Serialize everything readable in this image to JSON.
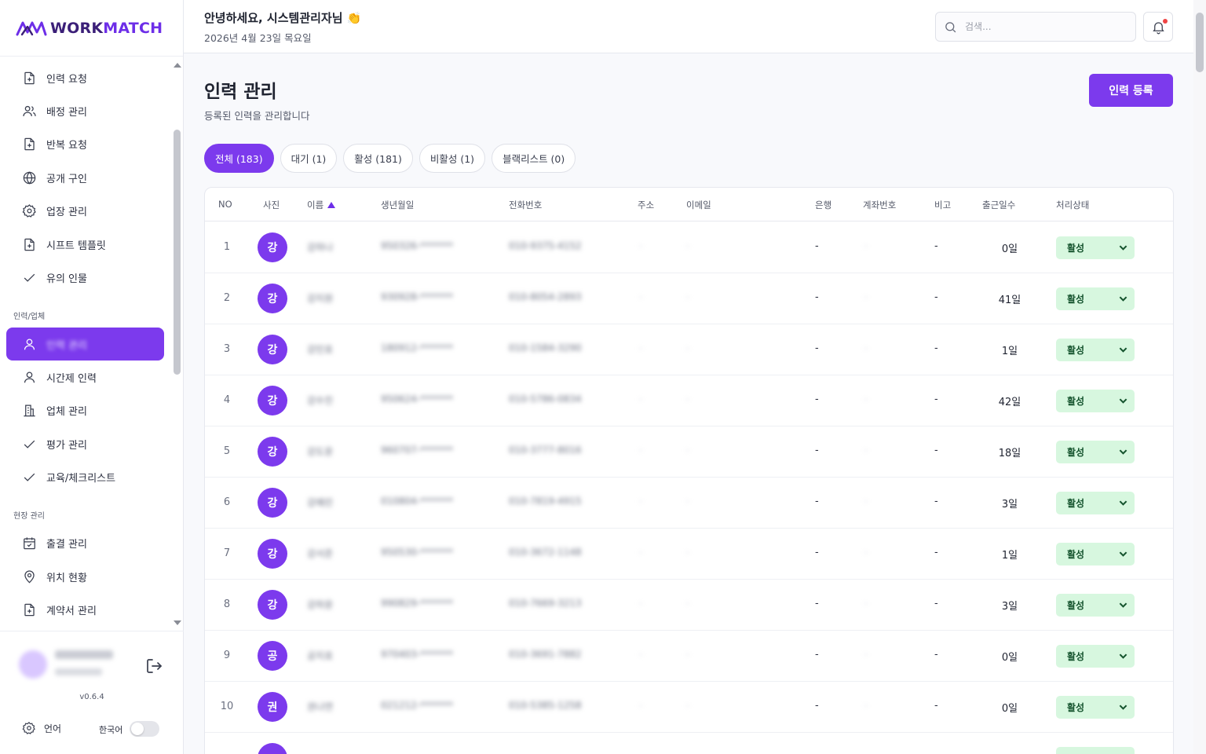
{
  "brand": {
    "name_a": "WORK",
    "name_b": "MATCH",
    "accent": "#7c3aed"
  },
  "sidebar": {
    "items": [
      {
        "label": "인력 요청",
        "icon": "file-plus-icon"
      },
      {
        "label": "배정 관리",
        "icon": "users-icon"
      },
      {
        "label": "반복 요청",
        "icon": "file-plus-icon"
      },
      {
        "label": "공개 구인",
        "icon": "globe-icon"
      },
      {
        "label": "업장 관리",
        "icon": "gear-icon"
      },
      {
        "label": "시프트 템플릿",
        "icon": "file-plus-icon"
      },
      {
        "label": "유의 인물",
        "icon": "check-icon"
      }
    ],
    "section1": "인력/업체",
    "items2": [
      {
        "label": "인력 관리",
        "icon": "user-icon",
        "active": true
      },
      {
        "label": "시간제 인력",
        "icon": "user-icon"
      },
      {
        "label": "업체 관리",
        "icon": "building-icon"
      },
      {
        "label": "평가 관리",
        "icon": "check-icon"
      },
      {
        "label": "교육/체크리스트",
        "icon": "check-icon"
      }
    ],
    "section2": "현장 관리",
    "items3": [
      {
        "label": "출결 관리",
        "icon": "calendar-icon"
      },
      {
        "label": "위치 현황",
        "icon": "map-pin-icon"
      },
      {
        "label": "계약서 관리",
        "icon": "file-plus-icon"
      }
    ],
    "version": "v0.6.4",
    "language_label": "언어",
    "language_value": "한국어"
  },
  "header": {
    "greeting": "안녕하세요, 시스템관리자님 👏",
    "date": "2026년 4월 23일 목요일",
    "search_placeholder": "검색..."
  },
  "main": {
    "title": "인력 관리",
    "subtitle": "등록된 인력을 관리합니다",
    "add_button": "인력 등록",
    "tabs": [
      "전체 (183)",
      "대기 (1)",
      "활성 (181)",
      "비활성 (1)",
      "블랙리스트 (0)"
    ]
  },
  "table": {
    "headers": [
      "NO",
      "사진",
      "이름",
      "생년월일",
      "전화번호",
      "주소",
      "이메일",
      "은행",
      "계좌번호",
      "비고",
      "출근일수",
      "처리상태"
    ],
    "rows": [
      {
        "no": "1",
        "initial": "강",
        "name": "강하나",
        "birth": "950326-*******",
        "phone": "010-9375-4152",
        "bank": "-",
        "note": "-",
        "days": "0일",
        "status": "활성"
      },
      {
        "no": "2",
        "initial": "강",
        "name": "강지원",
        "birth": "930928-*******",
        "phone": "010-8054-2893",
        "bank": "-",
        "note": "-",
        "days": "41일",
        "status": "활성"
      },
      {
        "no": "3",
        "initial": "강",
        "name": "강민호",
        "birth": "180912-*******",
        "phone": "010-1584-3290",
        "bank": "-",
        "note": "-",
        "days": "1일",
        "status": "활성"
      },
      {
        "no": "4",
        "initial": "강",
        "name": "강수진",
        "birth": "950624-*******",
        "phone": "010-5786-0834",
        "bank": "-",
        "note": "-",
        "days": "42일",
        "status": "활성"
      },
      {
        "no": "5",
        "initial": "강",
        "name": "강도윤",
        "birth": "960707-*******",
        "phone": "010-3777-8016",
        "bank": "-",
        "note": "-",
        "days": "18일",
        "status": "활성"
      },
      {
        "no": "6",
        "initial": "강",
        "name": "강예린",
        "birth": "010804-*******",
        "phone": "010-7819-4915",
        "bank": "-",
        "note": "-",
        "days": "3일",
        "status": "활성"
      },
      {
        "no": "7",
        "initial": "강",
        "name": "강서준",
        "birth": "950530-*******",
        "phone": "010-3672-1148",
        "bank": "-",
        "note": "-",
        "days": "1일",
        "status": "활성"
      },
      {
        "no": "8",
        "initial": "강",
        "name": "강하윤",
        "birth": "990829-*******",
        "phone": "010-7669-3213",
        "bank": "-",
        "note": "-",
        "days": "3일",
        "status": "활성"
      },
      {
        "no": "9",
        "initial": "공",
        "name": "공지호",
        "birth": "970403-*******",
        "phone": "010-3691-7882",
        "bank": "-",
        "note": "-",
        "days": "0일",
        "status": "활성"
      },
      {
        "no": "10",
        "initial": "권",
        "name": "권나연",
        "birth": "021212-*******",
        "phone": "010-5385-1258",
        "bank": "-",
        "note": "-",
        "days": "0일",
        "status": "활성"
      }
    ]
  }
}
